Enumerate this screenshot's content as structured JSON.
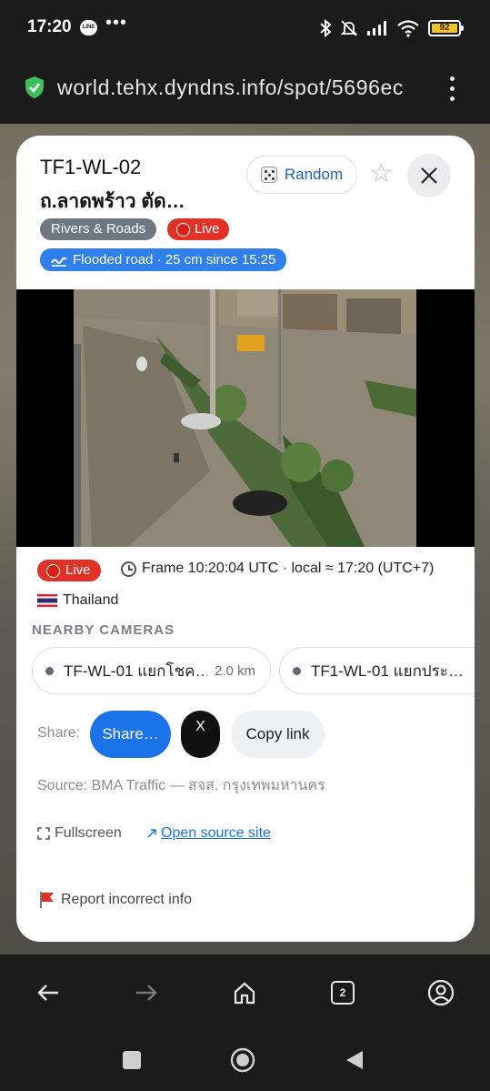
{
  "status_bar": {
    "time": "17:20",
    "line_badge": "LINE",
    "more": "•••",
    "battery": "92",
    "icons": [
      "bluetooth-icon",
      "mute-bell-icon",
      "signal-icon",
      "wifi-icon",
      "battery-icon"
    ]
  },
  "browser": {
    "url": "world.tehx.dyndns.info/spot/5696ec",
    "security_icon": "shield-check-icon",
    "menu_icon": "vertical-dots-icon"
  },
  "camera": {
    "id": "TF1-WL-02",
    "name": "ถ.ลาดพร้าว ตัด…",
    "random_label": "Random",
    "category": "Rivers & Roads",
    "live_label": "Live",
    "flood_status": "Flooded road · 25 cm since 15:25",
    "frame_info": "Frame 10:20:04 UTC · local ≈ 17:20 (UTC+7)",
    "country": "Thailand"
  },
  "nearby": {
    "heading": "NEARBY CAMERAS",
    "items": [
      {
        "name": "TF-WL-01 แยกโชค…",
        "distance": "2.0 km"
      },
      {
        "name": "TF1-WL-01 แยกประ…",
        "distance": ""
      }
    ]
  },
  "share": {
    "label": "Share:",
    "share_button": "Share…",
    "x_button": "X",
    "copy_button": "Copy link"
  },
  "source_text": "Source: BMA Traffic — สจส. กรุงเทพมหานคร",
  "links": {
    "fullscreen": "Fullscreen",
    "open_source": "Open source site",
    "report": "Report incorrect info"
  },
  "colors": {
    "live_red": "#e23127",
    "flood_blue": "#2f80ed",
    "accent_blue": "#1a73e8",
    "category_gray": "#6f7782"
  },
  "bottom_nav": {
    "tab_count": "2",
    "icons": [
      "back-arrow-icon",
      "forward-arrow-icon",
      "home-icon",
      "tabs-icon",
      "account-icon"
    ]
  }
}
